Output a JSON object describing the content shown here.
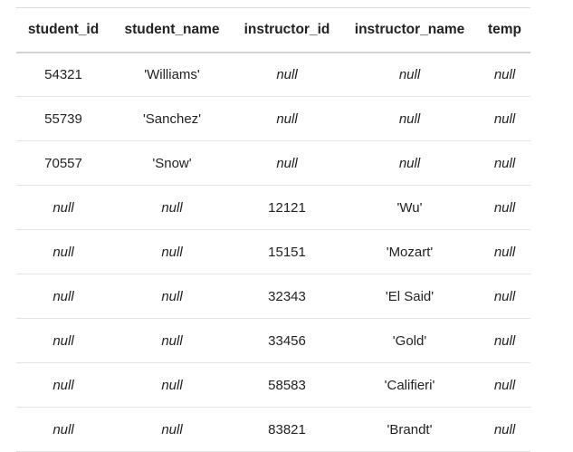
{
  "table": {
    "columns": [
      "student_id",
      "student_name",
      "instructor_id",
      "instructor_name",
      "temp"
    ],
    "rows": [
      [
        "54321",
        "'Williams'",
        "null",
        "null",
        "null"
      ],
      [
        "55739",
        "'Sanchez'",
        "null",
        "null",
        "null"
      ],
      [
        "70557",
        "'Snow'",
        "null",
        "null",
        "null"
      ],
      [
        "null",
        "null",
        "12121",
        "'Wu'",
        "null"
      ],
      [
        "null",
        "null",
        "15151",
        "'Mozart'",
        "null"
      ],
      [
        "null",
        "null",
        "32343",
        "'El Said'",
        "null"
      ],
      [
        "null",
        "null",
        "33456",
        "'Gold'",
        "null"
      ],
      [
        "null",
        "null",
        "58583",
        "'Califieri'",
        "null"
      ],
      [
        "null",
        "null",
        "83821",
        "'Brandt'",
        "null"
      ]
    ]
  }
}
